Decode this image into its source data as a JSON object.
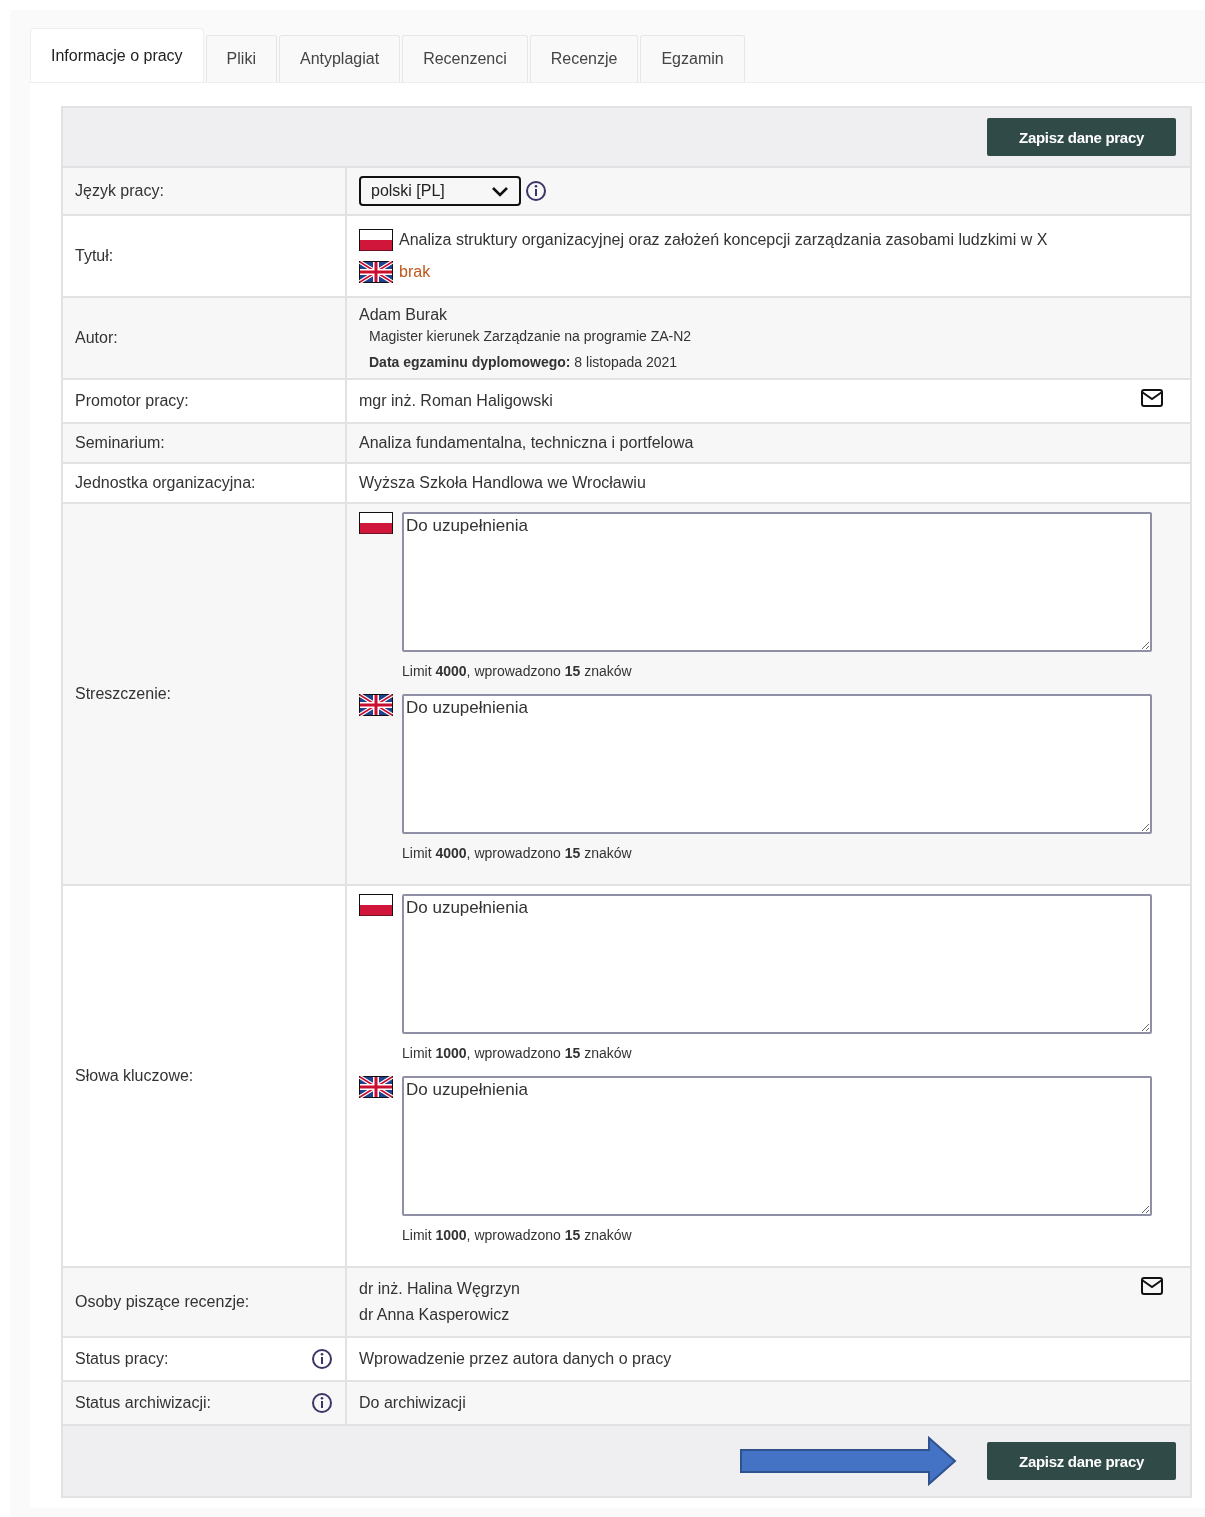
{
  "tabs": [
    {
      "label": "Informacje o pracy",
      "selected": true
    },
    {
      "label": "Pliki",
      "selected": false
    },
    {
      "label": "Antyplagiat",
      "selected": false
    },
    {
      "label": "Recenzenci",
      "selected": false
    },
    {
      "label": "Recenzje",
      "selected": false
    },
    {
      "label": "Egzamin",
      "selected": false
    }
  ],
  "top_button": "Zapisz dane pracy",
  "rows": [
    {
      "kind": "select",
      "label": "Język pracy:",
      "value": "polski [PL]",
      "info": true
    },
    {
      "kind": "titles",
      "label": "Tytuł:",
      "entries": [
        {
          "kind": "pl",
          "text": "Analiza struktury organizacyjnej oraz założeń koncepcji zarządzania zasobami ludzkimi w X",
          "missing": false
        },
        {
          "kind": "en",
          "text": "brak",
          "missing": true
        }
      ]
    },
    {
      "kind": "author",
      "label": "Autor:",
      "name": "Adam Burak",
      "program": "Magister kierunek Zarządzanie na programie ZA-N2",
      "exam": "**Data egzaminu dyplomowego:** 8 listopada 2021"
    },
    {
      "kind": "people",
      "label": "Promotor pracy:",
      "people": [
        "mgr inż. Roman Haligowski"
      ],
      "mail": true
    },
    {
      "kind": "text",
      "label": "Seminarium:",
      "value": "Analiza fundamentalna, techniczna i portfelowa"
    },
    {
      "kind": "text",
      "label": "Jednostka organizacyjna:",
      "value": "Wyższa Szkoła Handlowa we Wrocławiu"
    },
    {
      "kind": "textareas",
      "label": "Streszczenie:",
      "fields": [
        {
          "kind": "pl",
          "value": "Do uzupełnienia",
          "counter": "Limit **4000**, wprowadzono **15** znaków"
        },
        {
          "kind": "en",
          "value": "Do uzupełnienia",
          "counter": "Limit **4000**, wprowadzono **15** znaków"
        }
      ]
    },
    {
      "kind": "textareas",
      "label": "Słowa kluczowe:",
      "fields": [
        {
          "kind": "pl",
          "value": "Do uzupełnienia",
          "counter": "Limit **1000**, wprowadzono **15** znaków"
        },
        {
          "kind": "en",
          "value": "Do uzupełnienia",
          "counter": "Limit **1000**, wprowadzono **15** znaków"
        }
      ]
    },
    {
      "kind": "people",
      "label": "Osoby piszące recenzje:",
      "people": [
        "dr inż. Halina Węgrzyn",
        "dr Anna Kasperowicz"
      ],
      "mail": true
    },
    {
      "kind": "text",
      "label": "Status pracy:",
      "value": "Wprowadzenie przez autora danych o pracy",
      "info": true
    },
    {
      "kind": "text",
      "label": "Status archiwizacji:",
      "value": "Do archiwizacji",
      "info": true
    }
  ],
  "bottom_button": "Zapisz dane pracy"
}
